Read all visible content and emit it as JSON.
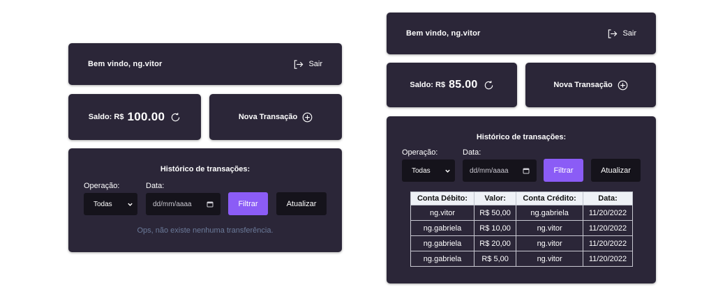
{
  "left": {
    "header": {
      "welcome": "Bem vindo, ng.vitor",
      "logout_label": "Sair"
    },
    "balance": {
      "label": "Saldo: R$",
      "value": "100.00"
    },
    "new_transaction": {
      "label": "Nova Transação"
    },
    "history": {
      "title": "Histórico de transações:",
      "operation_label": "Operação:",
      "operation_selected": "Todas",
      "date_label": "Data:",
      "date_placeholder": "dd/mm/aaaa",
      "filter_label": "Filtrar",
      "refresh_label": "Atualizar",
      "empty_message": "Ops, não existe nenhuma transferência."
    }
  },
  "right": {
    "header": {
      "welcome": "Bem vindo, ng.vitor",
      "logout_label": "Sair"
    },
    "balance": {
      "label": "Saldo: R$",
      "value": "85.00"
    },
    "new_transaction": {
      "label": "Nova Transação"
    },
    "history": {
      "title": "Histórico de transações:",
      "operation_label": "Operação:",
      "operation_selected": "Todas",
      "date_label": "Data:",
      "date_placeholder": "dd/mm/aaaa",
      "filter_label": "Filtrar",
      "refresh_label": "Atualizar",
      "table": {
        "headers": [
          "Conta Débito:",
          "Valor:",
          "Conta Crédito:",
          "Data:"
        ],
        "rows": [
          [
            "ng.vitor",
            "R$ 50,00",
            "ng.gabriela",
            "11/20/2022"
          ],
          [
            "ng.gabriela",
            "R$ 10,00",
            "ng.vitor",
            "11/20/2022"
          ],
          [
            "ng.gabriela",
            "R$ 20,00",
            "ng.vitor",
            "11/20/2022"
          ],
          [
            "ng.gabriela",
            "R$ 5,00",
            "ng.vitor",
            "11/20/2022"
          ]
        ]
      }
    }
  },
  "icons": {
    "logout": "logout-icon",
    "refresh": "refresh-icon",
    "add": "plus-circle-icon",
    "select_arrow": "chevron-down-icon",
    "calendar": "calendar-icon"
  },
  "colors": {
    "card": "#2b2638",
    "accent": "#8b5cf6",
    "control": "#15131b",
    "empty_text": "#6b7a99"
  }
}
